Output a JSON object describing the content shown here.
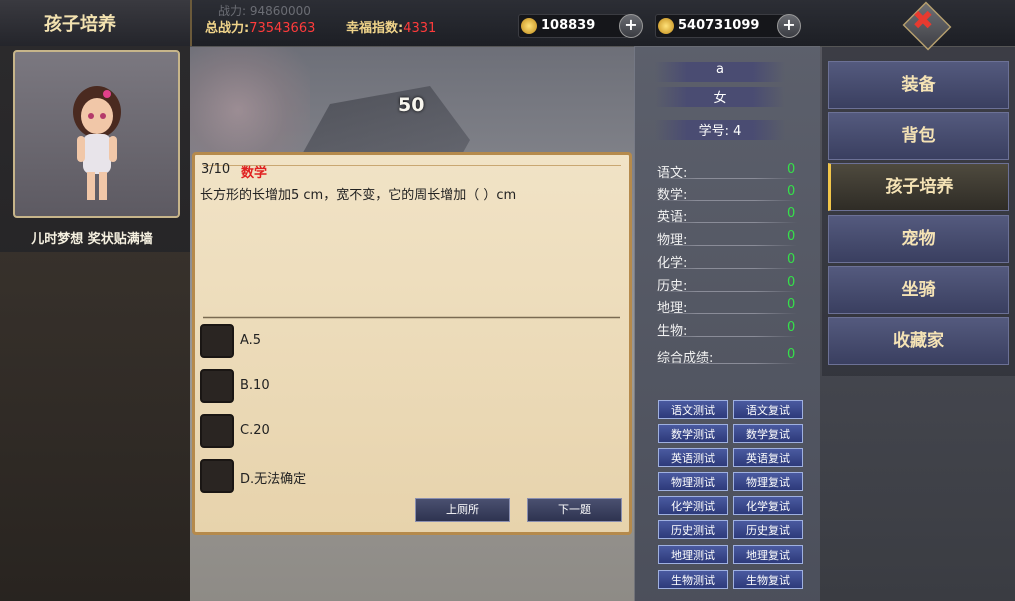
{
  "header": {
    "title": "孩子培养",
    "ghost_text": "战力: 94860000",
    "power_label": "总战力:",
    "power_value": "73543663",
    "happy_label": "幸福指数:",
    "happy_value": "4331",
    "gold": "108839",
    "coins": "540731099",
    "plus": "+",
    "close": "✖"
  },
  "left": {
    "description": "儿时梦想 奖状贴满墙"
  },
  "score": "50",
  "question": {
    "progress": "3/10",
    "subject": "数学",
    "text": "长方形的长增加5 cm，宽不变，它的周长增加（    ）cm",
    "options": [
      "A.5",
      "B.10",
      "C.20",
      "D.无法确定"
    ],
    "buttons": {
      "prev": "上厕所",
      "next": "下一题"
    }
  },
  "student": {
    "name": "a",
    "gender": "女",
    "id_label": "学号: 4",
    "subjects": [
      {
        "label": "语文:",
        "value": "0"
      },
      {
        "label": "数学:",
        "value": "0"
      },
      {
        "label": "英语:",
        "value": "0"
      },
      {
        "label": "物理:",
        "value": "0"
      },
      {
        "label": "化学:",
        "value": "0"
      },
      {
        "label": "历史:",
        "value": "0"
      },
      {
        "label": "地理:",
        "value": "0"
      },
      {
        "label": "生物:",
        "value": "0"
      },
      {
        "label": "综合成绩:",
        "value": "0"
      }
    ],
    "tests": [
      [
        "语文测试",
        "语文复试"
      ],
      [
        "数学测试",
        "数学复试"
      ],
      [
        "英语测试",
        "英语复试"
      ],
      [
        "物理测试",
        "物理复试"
      ],
      [
        "化学测试",
        "化学复试"
      ],
      [
        "历史测试",
        "历史复试"
      ],
      [
        "地理测试",
        "地理复试"
      ],
      [
        "生物测试",
        "生物复试"
      ]
    ]
  },
  "menu": [
    "装备",
    "背包",
    "孩子培养",
    "宠物",
    "坐骑",
    "收藏家"
  ],
  "colors": {
    "accent": "#f2c64a",
    "value_red": "#ff3b3b",
    "score_green": "#35e04a"
  }
}
